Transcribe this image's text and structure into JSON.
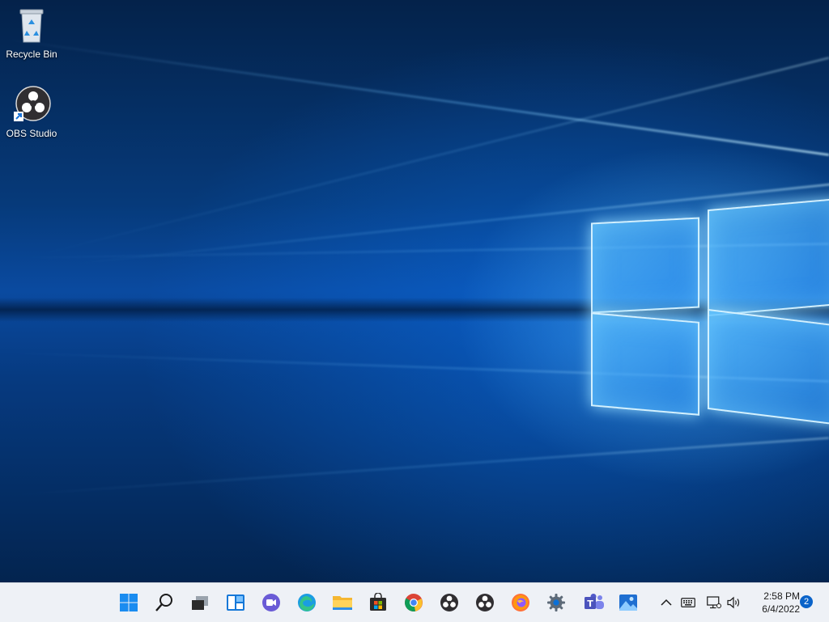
{
  "desktop": {
    "icons": [
      {
        "label": "Recycle Bin",
        "icon": "recycle-bin-icon"
      },
      {
        "label": "OBS Studio",
        "icon": "obs-studio-icon"
      }
    ]
  },
  "taskbar": {
    "apps": [
      {
        "name": "Start",
        "icon": "windows-start-icon"
      },
      {
        "name": "Search",
        "icon": "search-icon"
      },
      {
        "name": "Task View",
        "icon": "task-view-icon"
      },
      {
        "name": "Widgets",
        "icon": "widgets-icon"
      },
      {
        "name": "Chat",
        "icon": "teams-chat-icon"
      },
      {
        "name": "Microsoft Edge",
        "icon": "edge-icon"
      },
      {
        "name": "File Explorer",
        "icon": "folder-icon"
      },
      {
        "name": "Microsoft Store",
        "icon": "store-icon"
      },
      {
        "name": "Google Chrome",
        "icon": "chrome-icon"
      },
      {
        "name": "OBS Studio",
        "icon": "obs-icon"
      },
      {
        "name": "OBS Studio",
        "icon": "obs-icon"
      },
      {
        "name": "Firefox",
        "icon": "firefox-icon"
      },
      {
        "name": "Settings",
        "icon": "gear-icon"
      },
      {
        "name": "Microsoft Teams",
        "icon": "teams-icon"
      },
      {
        "name": "Photos",
        "icon": "photos-icon"
      }
    ],
    "tray": {
      "icons": [
        "chevron-up-icon",
        "keyboard-icon",
        "network-icon",
        "volume-icon"
      ],
      "time": "2:58 PM",
      "date": "6/4/2022",
      "notification_count": "2"
    }
  },
  "colors": {
    "taskbar_bg": "#eef1f6",
    "accent": "#0a63c9",
    "wallpaper_blue": "#0a4aa0"
  }
}
